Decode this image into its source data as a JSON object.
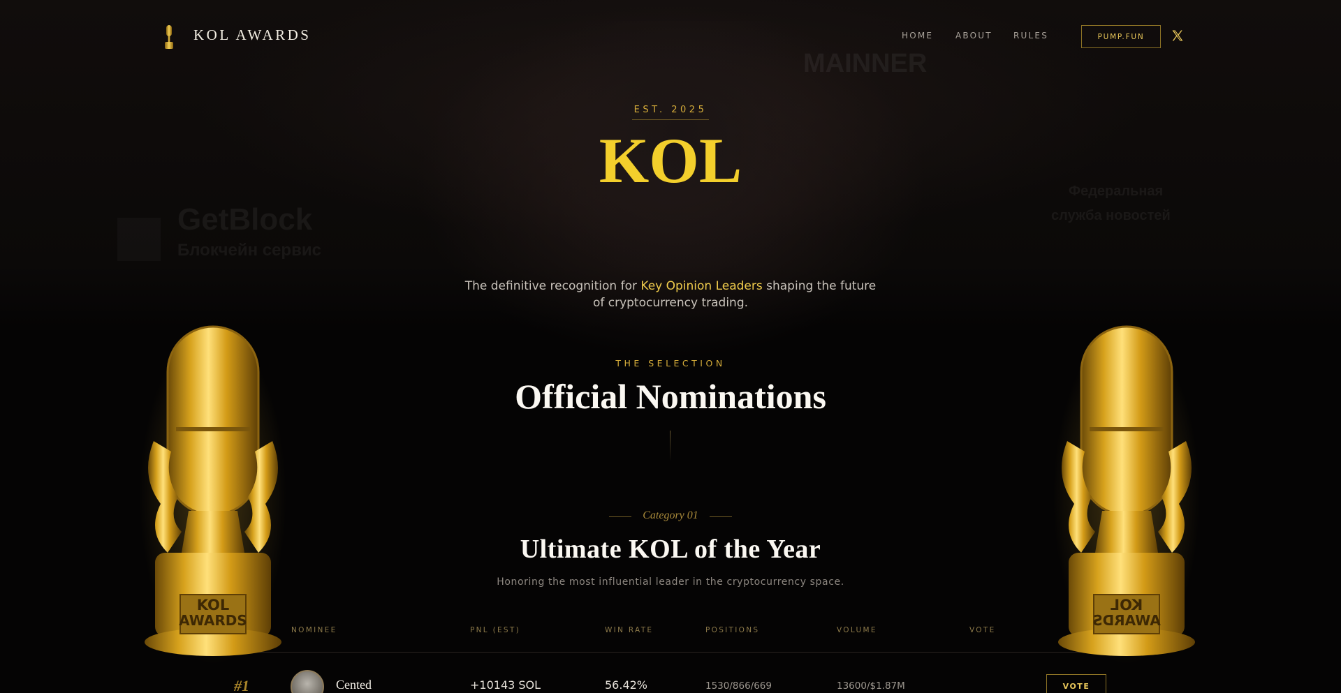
{
  "header": {
    "brand": "KOL AWARDS",
    "nav": [
      "HOME",
      "ABOUT",
      "RULES"
    ],
    "cta": "PUMP.FUN",
    "social_icon": "x-logo-icon"
  },
  "hero": {
    "est": "EST. 2025",
    "title": "KOL",
    "tagline_before": "The definitive recognition for ",
    "tagline_highlight": "Key Opinion Leaders",
    "tagline_after": " shaping the future of cryptocurrency trading."
  },
  "selection": {
    "label": "THE SELECTION",
    "title": "Official Nominations"
  },
  "category": {
    "label": "Category 01",
    "title": "Ultimate KOL of the Year",
    "description": "Honoring the most influential leader in the cryptocurrency space."
  },
  "table": {
    "columns": [
      "NOMINEE",
      "PNL (EST)",
      "WIN RATE",
      "POSITIONS",
      "VOLUME",
      "VOTE"
    ],
    "rows": [
      {
        "rank": "#1",
        "name": "Cented",
        "pnl": "+10143 SOL",
        "win_rate": "56.42%",
        "positions": "1530/866/669",
        "volume": "13600/$1.87M",
        "vote": "VOTE"
      }
    ]
  },
  "trophy": {
    "plaque_line1": "KOL",
    "plaque_line2": "AWARDS"
  },
  "background_text": [
    "GetBlock",
    "Блокчейн сервис",
    "MAINNER",
    "Федеральная",
    "служба новостей"
  ],
  "colors": {
    "gold": "#f3cf2c",
    "accent_gold": "#d6ad3a",
    "background": "#050404"
  }
}
